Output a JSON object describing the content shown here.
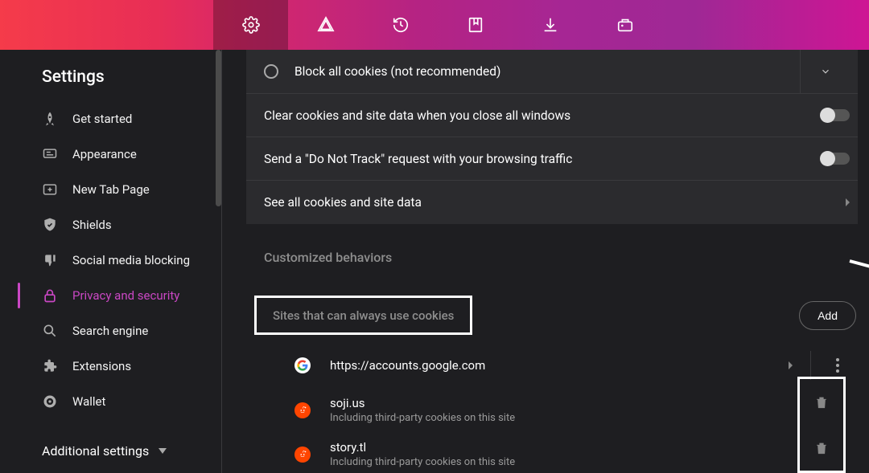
{
  "topbar": {
    "active_index": 0
  },
  "sidebar": {
    "title": "Settings",
    "items": [
      {
        "label": "Get started"
      },
      {
        "label": "Appearance"
      },
      {
        "label": "New Tab Page"
      },
      {
        "label": "Shields"
      },
      {
        "label": "Social media blocking"
      },
      {
        "label": "Privacy and security"
      },
      {
        "label": "Search engine"
      },
      {
        "label": "Extensions"
      },
      {
        "label": "Wallet"
      }
    ],
    "additional": "Additional settings"
  },
  "main": {
    "block_all": "Block all cookies (not recommended)",
    "clear_on_close": "Clear cookies and site data when you close all windows",
    "dnt": "Send a \"Do Not Track\" request with your browsing traffic",
    "see_all": "See all cookies and site data",
    "section": "Customized behaviors",
    "always_title": "Sites that can always use cookies",
    "add_label": "Add",
    "sites": [
      {
        "url": "https://accounts.google.com",
        "sub": "",
        "icon": "google"
      },
      {
        "url": "soji.us",
        "sub": "Including third-party cookies on this site",
        "icon": "reddit"
      },
      {
        "url": "story.tl",
        "sub": "Including third-party cookies on this site",
        "icon": "reddit"
      }
    ]
  }
}
